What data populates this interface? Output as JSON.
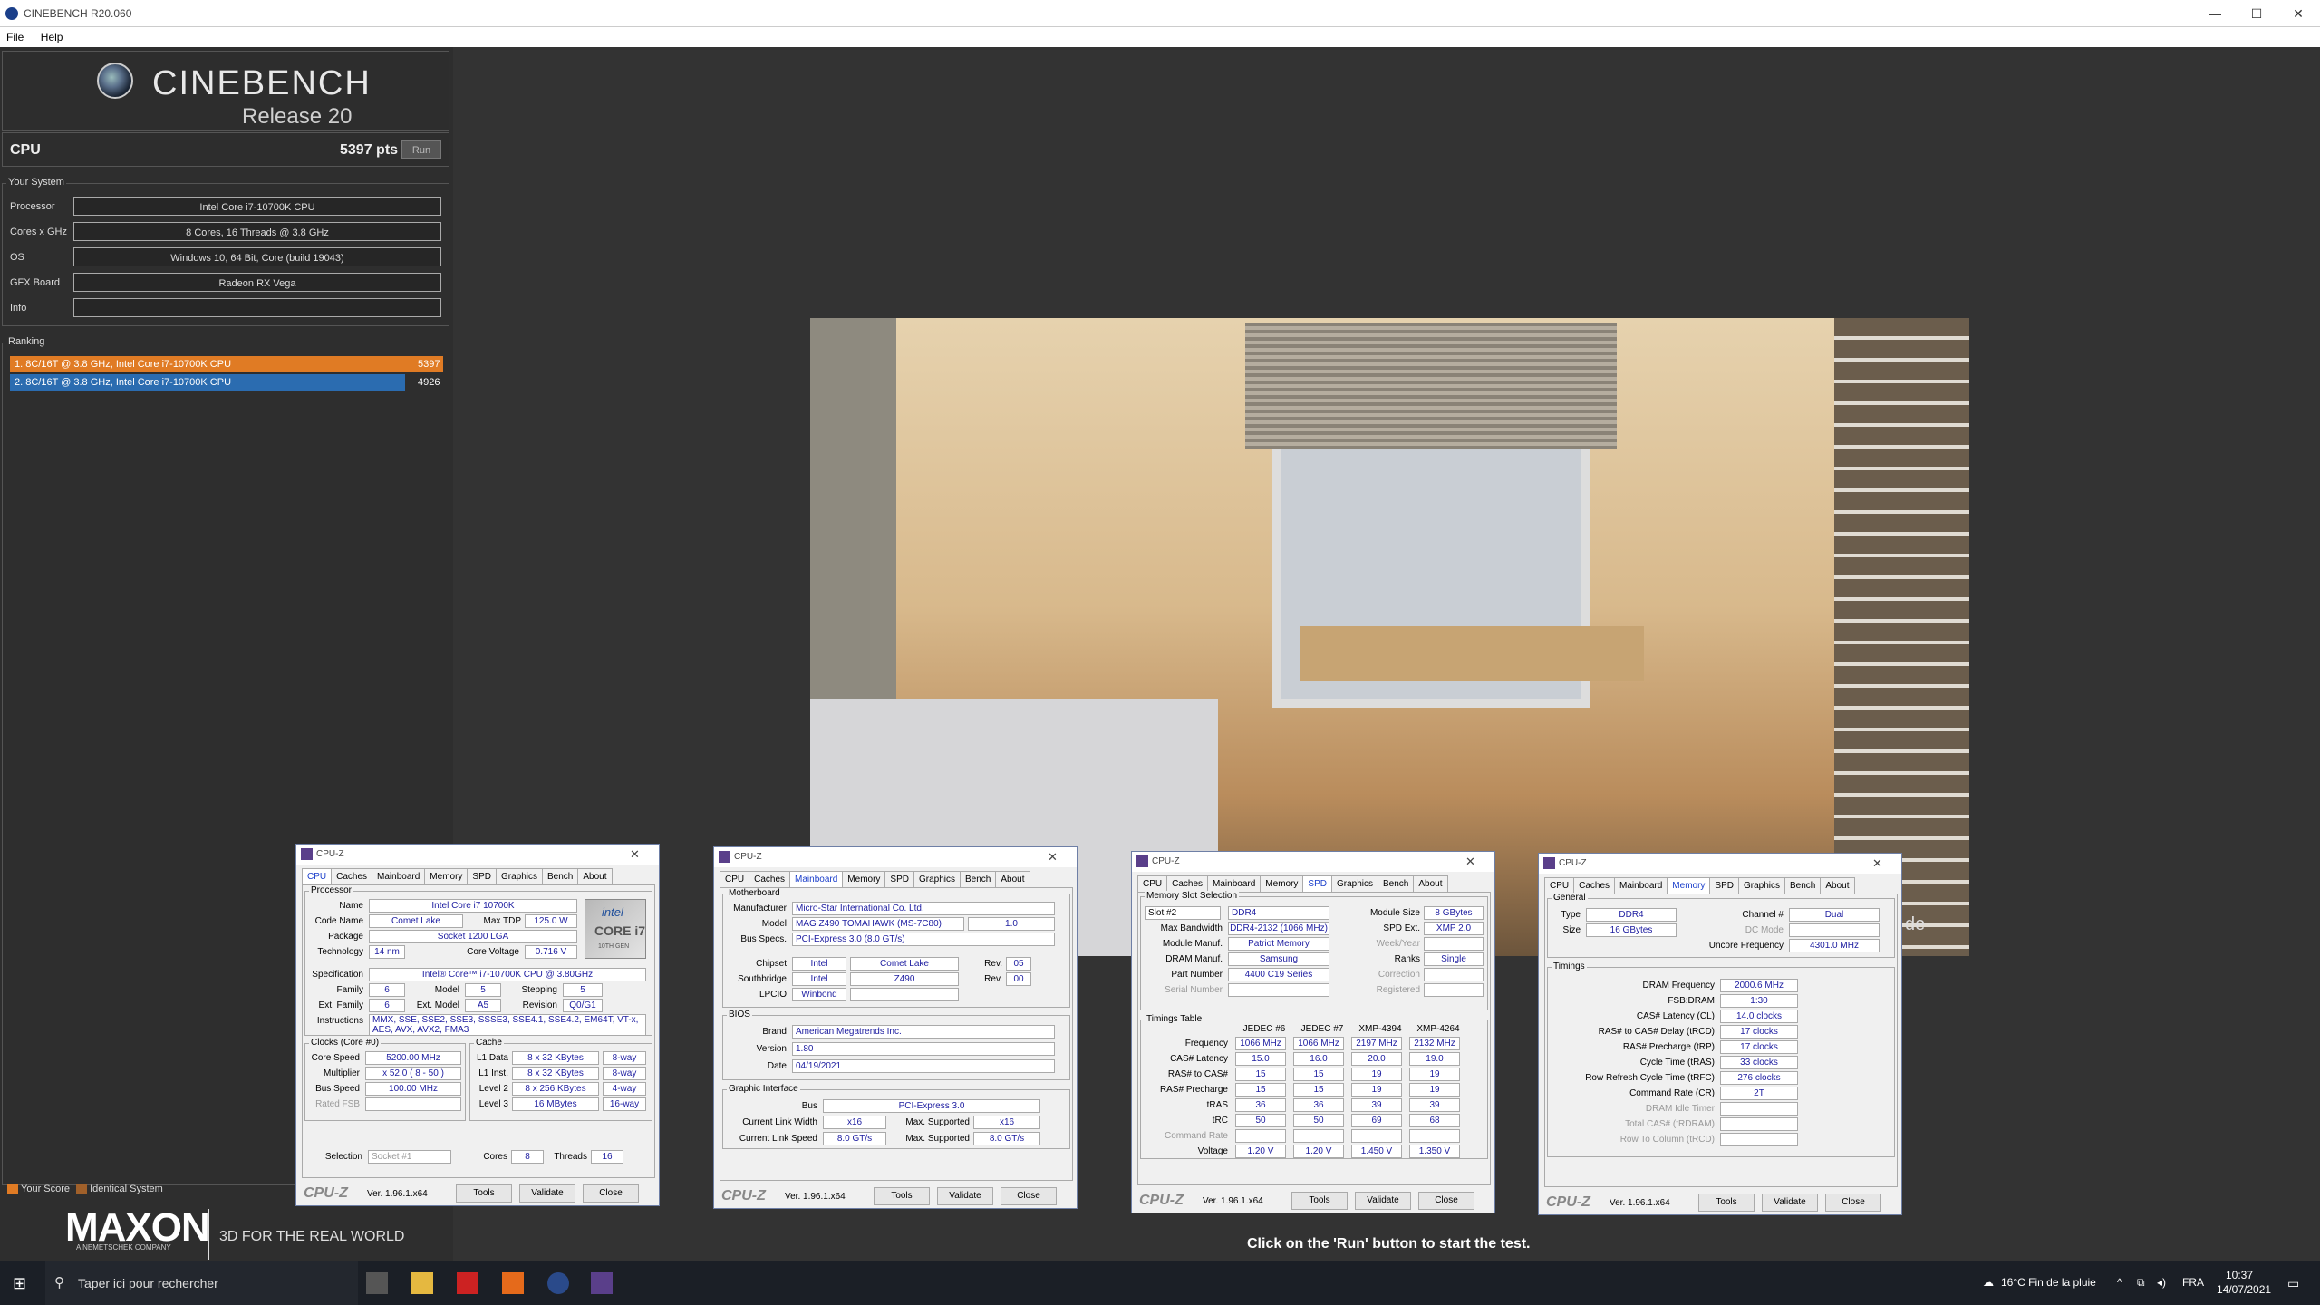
{
  "app": {
    "title": "CINEBENCH R20.060",
    "menu": [
      "File",
      "Help"
    ]
  },
  "logo": {
    "name": "CINEBENCH",
    "release": "Release 20"
  },
  "cpu": {
    "label": "CPU",
    "score": "5397 pts",
    "run": "Run"
  },
  "system": {
    "header": "Your System",
    "rows": [
      {
        "k": "Processor",
        "v": "Intel Core i7-10700K CPU"
      },
      {
        "k": "Cores x GHz",
        "v": "8 Cores, 16 Threads @ 3.8 GHz"
      },
      {
        "k": "OS",
        "v": "Windows 10, 64 Bit, Core (build 19043)"
      },
      {
        "k": "GFX Board",
        "v": "Radeon RX Vega"
      },
      {
        "k": "Info",
        "v": ""
      }
    ]
  },
  "ranking": {
    "header": "Ranking",
    "items": [
      {
        "label": "1. 8C/16T @ 3.8 GHz, Intel Core i7-10700K CPU",
        "score": "5397",
        "color": "#e07b24"
      },
      {
        "label": "2. 8C/16T @ 3.8 GHz, Intel Core i7-10700K CPU",
        "score": "4926",
        "color": "#2b6cb0"
      }
    ]
  },
  "legend": {
    "your": "Your Score",
    "identical": "Identical System"
  },
  "footer": {
    "maxon": "MAXON",
    "maxon_sub": "A NEMETSCHEK COMPANY",
    "tagline": "3D FOR THE REAL WORLD",
    "message": "Click on the 'Run' button to start the test."
  },
  "cpuz_common": {
    "title": "CPU-Z",
    "tabs": [
      "CPU",
      "Caches",
      "Mainboard",
      "Memory",
      "SPD",
      "Graphics",
      "Bench",
      "About"
    ],
    "brand": "CPU-Z",
    "version": "Ver. 1.96.1.x64",
    "tools": "Tools",
    "validate": "Validate",
    "close": "Close"
  },
  "cpuz1": {
    "processor_hd": "Processor",
    "name_l": "Name",
    "name": "Intel Core i7 10700K",
    "code_l": "Code Name",
    "code": "Comet Lake",
    "tdp_l": "Max TDP",
    "tdp": "125.0 W",
    "pkg_l": "Package",
    "pkg": "Socket 1200 LGA",
    "tech_l": "Technology",
    "tech": "14 nm",
    "volt_l": "Core Voltage",
    "volt": "0.716 V",
    "spec_l": "Specification",
    "spec": "Intel® Core™ i7-10700K CPU @ 3.80GHz",
    "fam_l": "Family",
    "fam": "6",
    "mod_l": "Model",
    "mod": "5",
    "step_l": "Stepping",
    "step": "5",
    "efam_l": "Ext. Family",
    "efam": "6",
    "emod_l": "Ext. Model",
    "emod": "A5",
    "rev_l": "Revision",
    "rev": "Q0/G1",
    "inst_l": "Instructions",
    "inst": "MMX, SSE, SSE2, SSE3, SSSE3, SSE4.1, SSE4.2, EM64T, VT-x, AES, AVX, AVX2, FMA3",
    "clocks_hd": "Clocks (Core #0)",
    "cs_l": "Core Speed",
    "cs": "5200.00 MHz",
    "mul_l": "Multiplier",
    "mul": "x 52.0 ( 8 - 50 )",
    "bus_l": "Bus Speed",
    "bus": "100.00 MHz",
    "fsb_l": "Rated FSB",
    "cache_hd": "Cache",
    "l1d_l": "L1 Data",
    "l1d": "8 x 32 KBytes",
    "l1d_w": "8-way",
    "l1i_l": "L1 Inst.",
    "l1i": "8 x 32 KBytes",
    "l1i_w": "8-way",
    "l2_l": "Level 2",
    "l2": "8 x 256 KBytes",
    "l2_w": "4-way",
    "l3_l": "Level 3",
    "l3": "16 MBytes",
    "l3_w": "16-way",
    "sel_l": "Selection",
    "sel": "Socket #1",
    "cores_l": "Cores",
    "cores": "8",
    "threads_l": "Threads",
    "threads": "16",
    "intel_logo": "intel",
    "intel_core": "CORE i7",
    "intel_gen": "10TH GEN"
  },
  "cpuz2": {
    "mb_hd": "Motherboard",
    "man_l": "Manufacturer",
    "man": "Micro-Star International Co. Ltd.",
    "model_l": "Model",
    "model": "MAG Z490 TOMAHAWK (MS-7C80)",
    "model_rev": "1.0",
    "busspec_l": "Bus Specs.",
    "busspec": "PCI-Express 3.0 (8.0 GT/s)",
    "chip_l": "Chipset",
    "chip1": "Intel",
    "chip2": "Comet Lake",
    "chip_rev_l": "Rev.",
    "chip_rev": "05",
    "sb_l": "Southbridge",
    "sb1": "Intel",
    "sb2": "Z490",
    "sb_rev_l": "Rev.",
    "sb_rev": "00",
    "lpcio_l": "LPCIO",
    "lpcio": "Winbond",
    "bios_hd": "BIOS",
    "brand_l": "Brand",
    "brand": "American Megatrends Inc.",
    "ver_l": "Version",
    "ver": "1.80",
    "date_l": "Date",
    "date": "04/19/2021",
    "gi_hd": "Graphic Interface",
    "gbus_l": "Bus",
    "gbus": "PCI-Express 3.0",
    "clw_l": "Current Link Width",
    "clw": "x16",
    "msw_l": "Max. Supported",
    "msw": "x16",
    "cls_l": "Current Link Speed",
    "cls": "8.0 GT/s",
    "mss_l": "Max. Supported",
    "mss": "8.0 GT/s"
  },
  "cpuz3": {
    "mss_hd": "Memory Slot Selection",
    "slot": "Slot #2",
    "type": "DDR4",
    "msize_l": "Module Size",
    "msize": "8 GBytes",
    "maxbw_l": "Max Bandwidth",
    "maxbw": "DDR4-2132 (1066 MHz)",
    "spdext_l": "SPD Ext.",
    "spdext": "XMP 2.0",
    "mman_l": "Module Manuf.",
    "mman": "Patriot Memory",
    "wy_l": "Week/Year",
    "dman_l": "DRAM Manuf.",
    "dman": "Samsung",
    "ranks_l": "Ranks",
    "ranks": "Single",
    "part_l": "Part Number",
    "part": "4400 C19 Series",
    "corr_l": "Correction",
    "serial_l": "Serial Number",
    "reg_l": "Registered",
    "tt_hd": "Timings Table",
    "cols": [
      "JEDEC #6",
      "JEDEC #7",
      "XMP-4394",
      "XMP-4264"
    ],
    "rows": [
      {
        "k": "Frequency",
        "v": [
          "1066 MHz",
          "1066 MHz",
          "2197 MHz",
          "2132 MHz"
        ]
      },
      {
        "k": "CAS# Latency",
        "v": [
          "15.0",
          "16.0",
          "20.0",
          "19.0"
        ]
      },
      {
        "k": "RAS# to CAS#",
        "v": [
          "15",
          "15",
          "19",
          "19"
        ]
      },
      {
        "k": "RAS# Precharge",
        "v": [
          "15",
          "15",
          "19",
          "19"
        ]
      },
      {
        "k": "tRAS",
        "v": [
          "36",
          "36",
          "39",
          "39"
        ]
      },
      {
        "k": "tRC",
        "v": [
          "50",
          "50",
          "69",
          "68"
        ]
      },
      {
        "k": "Command Rate",
        "v": [
          "",
          "",
          "",
          ""
        ]
      },
      {
        "k": "Voltage",
        "v": [
          "1.20 V",
          "1.20 V",
          "1.450 V",
          "1.350 V"
        ]
      }
    ]
  },
  "cpuz4": {
    "gen_hd": "General",
    "type_l": "Type",
    "type": "DDR4",
    "ch_l": "Channel #",
    "ch": "Dual",
    "size_l": "Size",
    "size": "16 GBytes",
    "dc_l": "DC Mode",
    "unc_l": "Uncore Frequency",
    "unc": "4301.0 MHz",
    "tim_hd": "Timings",
    "rows": [
      {
        "k": "DRAM Frequency",
        "v": "2000.6 MHz"
      },
      {
        "k": "FSB:DRAM",
        "v": "1:30"
      },
      {
        "k": "CAS# Latency (CL)",
        "v": "14.0 clocks"
      },
      {
        "k": "RAS# to CAS# Delay (tRCD)",
        "v": "17 clocks"
      },
      {
        "k": "RAS# Precharge (tRP)",
        "v": "17 clocks"
      },
      {
        "k": "Cycle Time (tRAS)",
        "v": "33 clocks"
      },
      {
        "k": "Row Refresh Cycle Time (tRFC)",
        "v": "276 clocks"
      },
      {
        "k": "Command Rate (CR)",
        "v": "2T"
      },
      {
        "k": "DRAM Idle Timer",
        "v": ""
      },
      {
        "k": "Total CAS# (tRDRAM)",
        "v": ""
      },
      {
        "k": "Row To Column (tRCD)",
        "v": ""
      }
    ]
  },
  "taskbar": {
    "search": "Taper ici pour rechercher",
    "weather": "16°C  Fin de la pluie",
    "lang": "FRA",
    "time": "10:37",
    "date": "14/07/2021"
  },
  "watermark": "de"
}
